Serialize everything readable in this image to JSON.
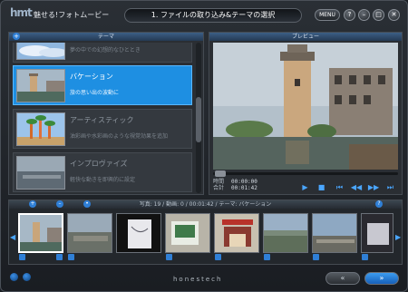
{
  "app": {
    "logo": "hmt",
    "title": "魅せる!フォトムービー"
  },
  "titlebar": {
    "step_title": "1. ファイルの取り込み&テーマの選択",
    "menu_label": "MENU",
    "help_label": "?",
    "minimize_label": "–",
    "maximize_label": "□",
    "close_label": "✕"
  },
  "theme_panel": {
    "header": "テーマ",
    "items": [
      {
        "name": "",
        "desc": "夢の中での幻想的なひととき"
      },
      {
        "name": "バケーション",
        "desc": "旅の思い出の波動に",
        "selected": true
      },
      {
        "name": "アーティスティック",
        "desc": "油彩画や水彩画のような視覚効果を追加"
      },
      {
        "name": "インプロヴァイズ",
        "desc": "軽快な動きを即興的に設定"
      }
    ]
  },
  "preview_panel": {
    "header": "プレビュー",
    "time_label_1": "時間",
    "time_label_2": "合計",
    "time_value_1": "00:00:00",
    "time_value_2": "00:01:42",
    "buttons": [
      "▶",
      "■",
      "⏮",
      "◀◀",
      "▶▶",
      "⏭"
    ]
  },
  "timeline": {
    "header": "写真: 19 / 動画: 0 / 00:01:42 / テーマ: バケーション"
  },
  "footer": {
    "brand": "honestech",
    "back_label": "«",
    "next_label": "»"
  },
  "icons": [
    "add-icon",
    "remove-icon",
    "play-icon",
    "stop-icon",
    "prev-icon",
    "next-icon",
    "help-icon"
  ]
}
